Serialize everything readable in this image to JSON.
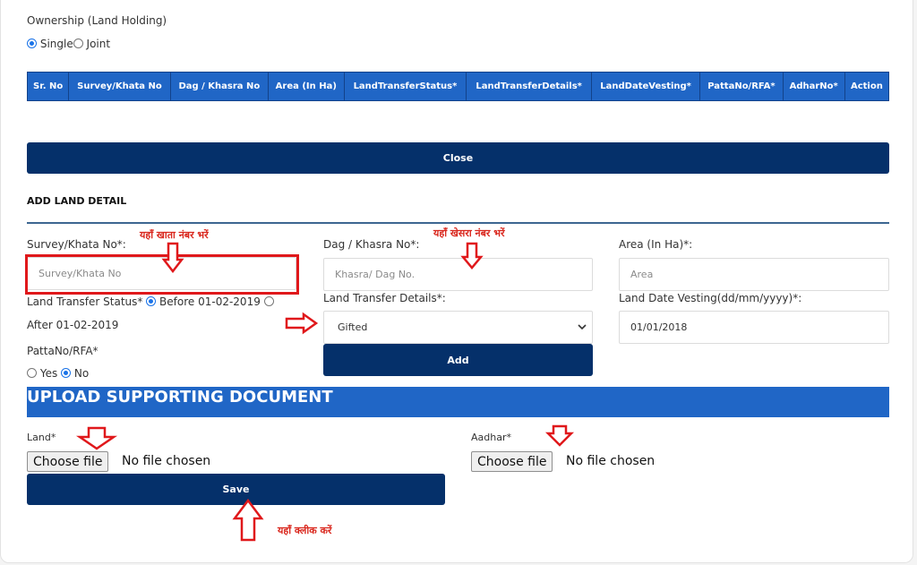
{
  "ownership": {
    "label": "Ownership (Land Holding)",
    "options": [
      {
        "label": "Single",
        "selected": true
      },
      {
        "label": "Joint",
        "selected": false
      }
    ]
  },
  "land_table": {
    "columns": [
      "Sr. No",
      "Survey/Khata No",
      "Dag / Khasra No",
      "Area (In Ha)",
      "LandTransferStatus*",
      "LandTransferDetails*",
      "LandDateVesting*",
      "PattaNo/RFA*",
      "AdharNo*",
      "Action"
    ],
    "rows": []
  },
  "close_button": "Close",
  "add_land_detail": {
    "heading": "ADD LAND DETAIL",
    "survey": {
      "label": "Survey/Khata No*:",
      "placeholder": "Survey/Khata No",
      "value": ""
    },
    "khasra": {
      "label": "Dag / Khasra No*:",
      "placeholder": "Khasra/ Dag No.",
      "value": ""
    },
    "area": {
      "label": "Area (In Ha)*:",
      "placeholder": "Area",
      "value": ""
    },
    "transfer_status": {
      "label": "Land Transfer Status*",
      "options": [
        {
          "label": "Before 01-02-2019",
          "selected": true
        },
        {
          "label": "After 01-02-2019",
          "selected": false
        }
      ]
    },
    "transfer_details": {
      "label": "Land Transfer Details*:",
      "selected": "Gifted"
    },
    "date_vesting": {
      "label": "Land Date Vesting(dd/mm/yyyy)*:",
      "value": "01/01/2018"
    },
    "patta": {
      "label": "PattaNo/RFA*",
      "options": [
        {
          "label": "Yes",
          "selected": false
        },
        {
          "label": "No",
          "selected": true
        }
      ]
    },
    "add_button": "Add"
  },
  "upload": {
    "heading": "UPLOAD SUPPORTING DOCUMENT",
    "land": {
      "label": "Land*",
      "button": "Choose file",
      "status": "No file chosen"
    },
    "aadhar": {
      "label": "Aadhar*",
      "button": "Choose file",
      "status": "No file chosen"
    },
    "save_button": "Save"
  },
  "annotations": {
    "survey_hint": "यहाँ खाता नंबर भरें",
    "khasra_hint": "यहाँ खेसरा नंबर भरें",
    "save_hint": "यहाँ क्लीक करें",
    "highlight_color": "#e0181b"
  }
}
